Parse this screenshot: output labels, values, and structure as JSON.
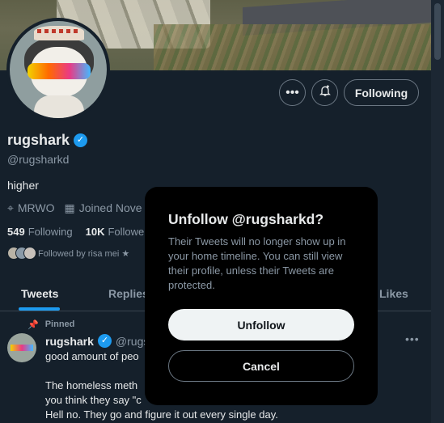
{
  "profile": {
    "name": "rugshark",
    "handle": "@rugsharkd",
    "bio": "higher",
    "location": "MRWO",
    "joined": "Joined Nove",
    "following_count": "549",
    "following_label": "Following",
    "followers_count": "10K",
    "followers_label": "Followe",
    "followed_by": "Followed by risa mei ★"
  },
  "actions": {
    "more_icon": "more-horizontal-icon",
    "notify_icon": "bell-plus-icon",
    "following_label": "Following"
  },
  "tabs": [
    {
      "label": "Tweets",
      "active": true
    },
    {
      "label": "Replies",
      "active": false
    },
    {
      "label": "Likes",
      "active": false
    }
  ],
  "tweet": {
    "pinned_label": "Pinned",
    "author": "rugshark",
    "handle_partial": "@rugsh",
    "text": "good amount of peo                                                      ay this\n\nThe homeless meth                                                       roke. Do\nyou think they say \"c                                                       meth\".\nHell no. They go and figure it out every single day."
  },
  "dialog": {
    "title": "Unfollow @rugsharkd?",
    "body": "Their Tweets will no longer show up in your home timeline. You can still view their profile, unless their Tweets are protected.",
    "confirm_label": "Unfollow",
    "cancel_label": "Cancel"
  },
  "colors": {
    "background": "#15202b",
    "accent": "#1d9bf0",
    "dialog_bg": "#000000"
  }
}
